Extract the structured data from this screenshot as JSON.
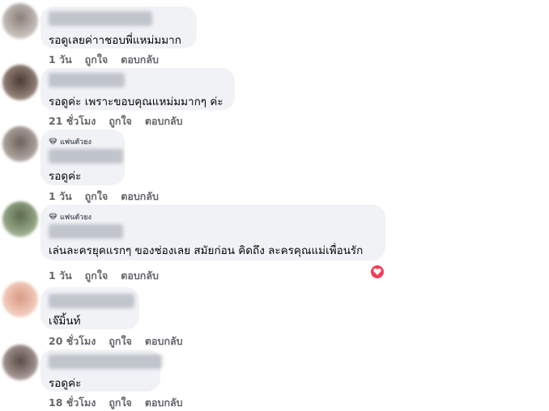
{
  "badge_label": "แฟนตัวยง",
  "comments": [
    {
      "text": "รอดูเลยค่าาชอบพี่แหม่มมาก",
      "time": "1 วัน",
      "like": "ถูกใจ",
      "reply": "ตอบกลับ"
    },
    {
      "text": "รอดูค่ะ เพราะขอบคุณแหม่มมากๆ ค่ะ",
      "time": "21 ชั่วโมง",
      "like": "ถูกใจ",
      "reply": "ตอบกลับ"
    },
    {
      "text": "รอดูค่ะ",
      "time": "1 วัน",
      "like": "ถูกใจ",
      "reply": "ตอบกลับ"
    },
    {
      "text": "เล่นละครยุคแรกๆ ของช่องเลย สมัยก่อน คิดถึง ละครคุณแม่เพื่อนรัก",
      "time": "1 วัน",
      "like": "ถูกใจ",
      "reply": "ตอบกลับ"
    },
    {
      "text": "เจ๊มิ้นท์",
      "time": "20 ชั่วโมง",
      "like": "ถูกใจ",
      "reply": "ตอบกลับ"
    },
    {
      "text": "รอดูค่ะ",
      "time": "18 ชั่วโมง",
      "like": "ถูกใจ",
      "reply": "ตอบกลับ"
    }
  ],
  "reaction_icon": "heart-icon",
  "colors": {
    "bubble": "#f0f2f5",
    "meta": "#65676b",
    "heart": "#f33e58"
  }
}
